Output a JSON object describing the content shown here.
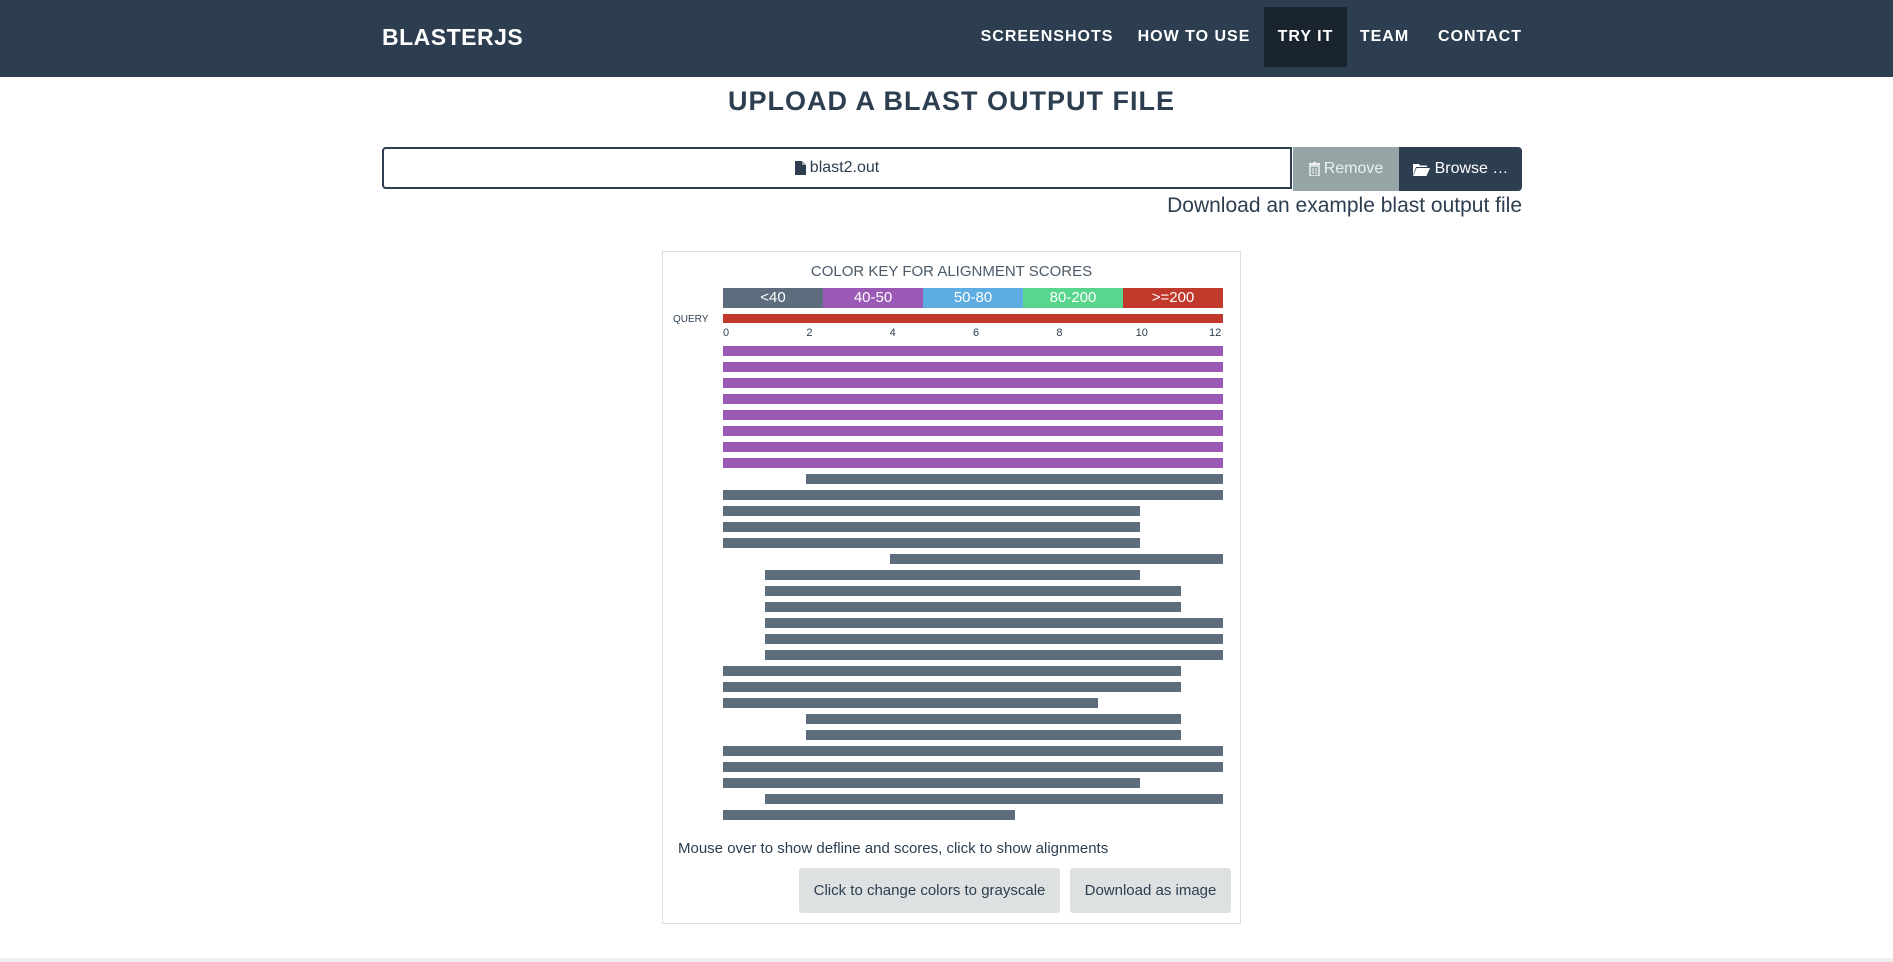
{
  "nav": {
    "brand": "BLASTERJS",
    "items": [
      {
        "label": "SCREENSHOTS",
        "active": false
      },
      {
        "label": "HOW TO USE",
        "active": false
      },
      {
        "label": "TRY IT",
        "active": true
      },
      {
        "label": "TEAM",
        "active": false
      },
      {
        "label": "CONTACT",
        "active": false
      }
    ]
  },
  "main": {
    "title": "UPLOAD A BLAST OUTPUT FILE",
    "file_name": "blast2.out",
    "remove_label": "Remove",
    "browse_label": "Browse …",
    "example_link": "Download an example blast output file"
  },
  "alignment": {
    "key_title": "COLOR KEY FOR ALIGNMENT SCORES",
    "key": [
      {
        "label": "<40",
        "color": "#5d6d7e"
      },
      {
        "label": "40-50",
        "color": "#9b59b6"
      },
      {
        "label": "50-80",
        "color": "#5dade2"
      },
      {
        "label": "80-200",
        "color": "#58d68d"
      },
      {
        "label": ">=200",
        "color": "#c0392b"
      }
    ],
    "query_label": "QUERY",
    "query_color": "#c0392b",
    "ticks": [
      "0",
      "2",
      "4",
      "6",
      "8",
      "10",
      "12"
    ],
    "hits": [
      {
        "start": 0,
        "end": 12,
        "score_class": "40-50"
      },
      {
        "start": 0,
        "end": 12,
        "score_class": "40-50"
      },
      {
        "start": 0,
        "end": 12,
        "score_class": "40-50"
      },
      {
        "start": 0,
        "end": 12,
        "score_class": "40-50"
      },
      {
        "start": 0,
        "end": 12,
        "score_class": "40-50"
      },
      {
        "start": 0,
        "end": 12,
        "score_class": "40-50"
      },
      {
        "start": 0,
        "end": 12,
        "score_class": "40-50"
      },
      {
        "start": 0,
        "end": 12,
        "score_class": "40-50"
      },
      {
        "start": 2,
        "end": 12,
        "score_class": "<40"
      },
      {
        "start": 0,
        "end": 12,
        "score_class": "<40"
      },
      {
        "start": 0,
        "end": 10,
        "score_class": "<40"
      },
      {
        "start": 0,
        "end": 10,
        "score_class": "<40"
      },
      {
        "start": 0,
        "end": 10,
        "score_class": "<40"
      },
      {
        "start": 4,
        "end": 12,
        "score_class": "<40"
      },
      {
        "start": 1,
        "end": 10,
        "score_class": "<40"
      },
      {
        "start": 1,
        "end": 11,
        "score_class": "<40"
      },
      {
        "start": 1,
        "end": 11,
        "score_class": "<40"
      },
      {
        "start": 1,
        "end": 12,
        "score_class": "<40"
      },
      {
        "start": 1,
        "end": 12,
        "score_class": "<40"
      },
      {
        "start": 1,
        "end": 12,
        "score_class": "<40"
      },
      {
        "start": 0,
        "end": 11,
        "score_class": "<40"
      },
      {
        "start": 0,
        "end": 11,
        "score_class": "<40"
      },
      {
        "start": 0,
        "end": 9,
        "score_class": "<40"
      },
      {
        "start": 2,
        "end": 11,
        "score_class": "<40"
      },
      {
        "start": 2,
        "end": 11,
        "score_class": "<40"
      },
      {
        "start": 0,
        "end": 12,
        "score_class": "<40"
      },
      {
        "start": 0,
        "end": 12,
        "score_class": "<40"
      },
      {
        "start": 0,
        "end": 10,
        "score_class": "<40"
      },
      {
        "start": 1,
        "end": 12,
        "score_class": "<40"
      },
      {
        "start": 0,
        "end": 7,
        "score_class": "<40"
      }
    ],
    "hint": "Mouse over to show defline and scores, click to show alignments",
    "grayscale_label": "Click to change colors to grayscale",
    "download_image_label": "Download as image"
  }
}
